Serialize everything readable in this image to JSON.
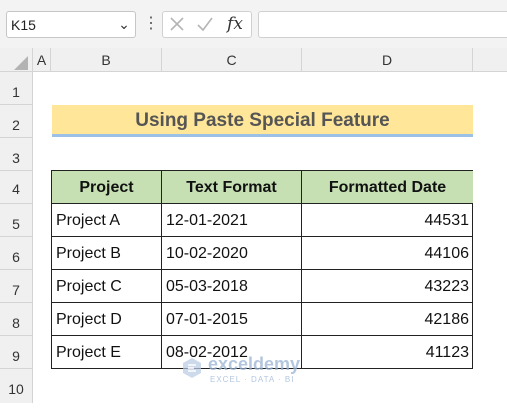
{
  "formula_bar": {
    "name_box": "K15",
    "more_icon": "vertical-ellipsis-icon",
    "cancel_icon": "cancel-x-icon",
    "enter_icon": "checkmark-icon",
    "fx_label": "fx",
    "formula_value": ""
  },
  "columns": [
    "A",
    "B",
    "C",
    "D"
  ],
  "rows": [
    "1",
    "2",
    "3",
    "4",
    "5",
    "6",
    "7",
    "8",
    "9",
    "10"
  ],
  "sheet": {
    "title": "Using Paste Special Feature",
    "table": {
      "headers": [
        "Project",
        "Text Format",
        "Formatted Date"
      ],
      "rows": [
        [
          "Project A",
          "12-01-2021",
          "44531"
        ],
        [
          "Project B",
          "10-02-2020",
          "44106"
        ],
        [
          "Project C",
          "05-03-2018",
          "43223"
        ],
        [
          "Project D",
          "07-01-2015",
          "42186"
        ],
        [
          "Project E",
          "08-02-2012",
          "41123"
        ]
      ]
    }
  },
  "watermark": {
    "name": "exceldemy",
    "tagline": "EXCEL · DATA · BI"
  },
  "colors": {
    "title_fill": "#ffe699",
    "title_border": "#9bc2e6",
    "header_fill": "#c6e0b4"
  }
}
